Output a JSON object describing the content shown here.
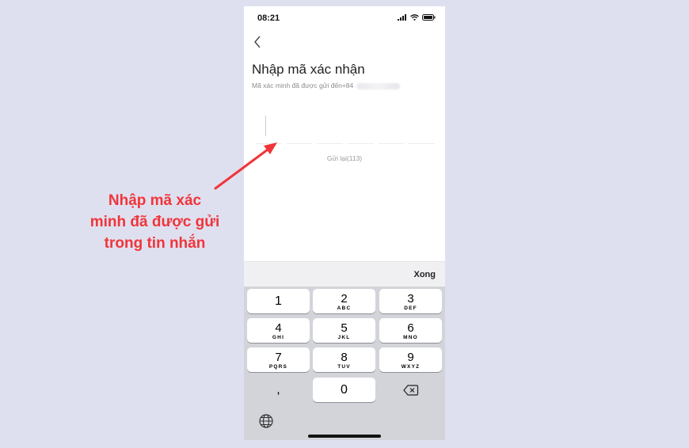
{
  "status_bar": {
    "time": "08:21"
  },
  "header": {
    "title": "Nhập mã xác nhận",
    "subtitle": "Mã xác minh đã được gửi đến+84",
    "resend": "Gửi lại(113)"
  },
  "keyboard": {
    "done_label": "Xong",
    "keys": [
      {
        "num": "1",
        "letters": ""
      },
      {
        "num": "2",
        "letters": "ABC"
      },
      {
        "num": "3",
        "letters": "DEF"
      },
      {
        "num": "4",
        "letters": "GHI"
      },
      {
        "num": "5",
        "letters": "JKL"
      },
      {
        "num": "6",
        "letters": "MNO"
      },
      {
        "num": "7",
        "letters": "PQRS"
      },
      {
        "num": "8",
        "letters": "TUV"
      },
      {
        "num": "9",
        "letters": "WXYZ"
      }
    ],
    "comma": ",",
    "zero": "0"
  },
  "annotation": {
    "line1": "Nhập mã xác",
    "line2": "minh đã được gửi",
    "line3": "trong tin nhắn",
    "color": "#f0353a"
  }
}
